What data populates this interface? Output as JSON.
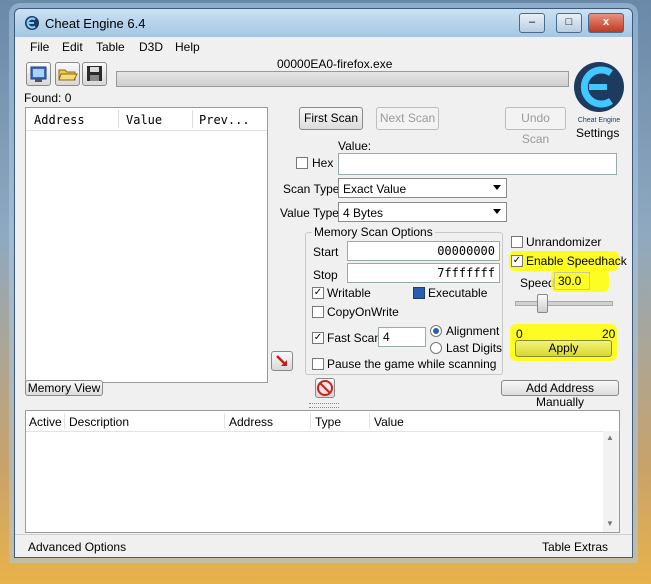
{
  "window": {
    "title": "Cheat Engine 6.4",
    "minimize_glyph": "–",
    "maximize_glyph": "□",
    "close_glyph": "x"
  },
  "menu": [
    "File",
    "Edit",
    "Table",
    "D3D",
    "Help"
  ],
  "toolbar": {
    "process_name": "00000EA0-firefox.exe",
    "found_label": "Found: 0",
    "settings_label": "Settings",
    "icons": [
      "open-process-icon",
      "open-file-icon",
      "save-icon"
    ],
    "logo_text": "Cheat Engine"
  },
  "results_list": {
    "columns": [
      "Address",
      "Value",
      "Prev..."
    ]
  },
  "scan": {
    "first_scan": "First Scan",
    "next_scan": "Next Scan",
    "undo_scan": "Undo Scan",
    "value_label": "Value:",
    "hex_label": "Hex",
    "scan_type_label": "Scan Type",
    "scan_type_value": "Exact Value",
    "value_type_label": "Value Type",
    "value_type_value": "4 Bytes"
  },
  "memory_options": {
    "title": "Memory Scan Options",
    "start_label": "Start",
    "start_value": "00000000",
    "stop_label": "Stop",
    "stop_value": "7fffffff",
    "writable": "Writable",
    "executable": "Executable",
    "copy_on_write": "CopyOnWrite",
    "fast_scan": "Fast Scan",
    "fast_scan_value": "4",
    "alignment": "Alignment",
    "last_digits": "Last Digits",
    "pause_game": "Pause the game while scanning"
  },
  "speedhack": {
    "unrandomizer": "Unrandomizer",
    "enable_label": "Enable Speedhack",
    "speed_label": "Speed",
    "speed_value": "30.0",
    "slider_min": "0",
    "slider_max": "20",
    "slider_level": 0.25,
    "apply": "Apply",
    "highlight_color": "#ffff00"
  },
  "bottom_bar": {
    "memory_view": "Memory View",
    "add_address": "Add Address Manually"
  },
  "address_table": {
    "columns": [
      "Active",
      "Description",
      "Address",
      "Type",
      "Value"
    ],
    "scroll_up": "▲",
    "scroll_down": "▼"
  },
  "status": {
    "advanced_options": "Advanced Options",
    "table_extras": "Table Extras"
  }
}
